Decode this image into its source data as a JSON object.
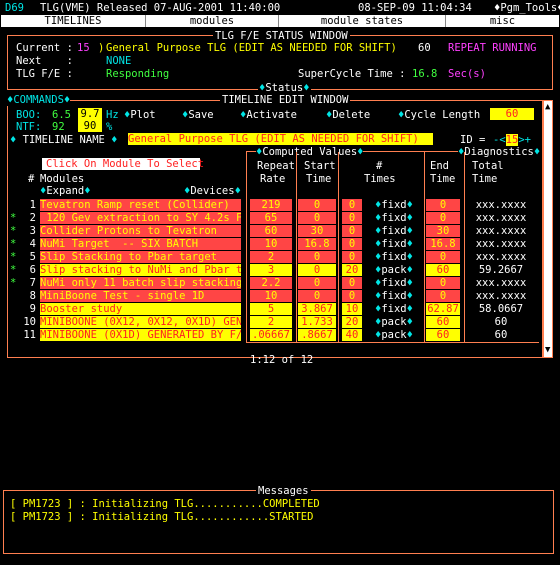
{
  "header": {
    "console": "D69",
    "app": "TLG(VME) Released 07-AUG-2001 11:40:00",
    "datetime": "08-SEP-09 11:04:34",
    "tools": "♦Pgm_Tools♦"
  },
  "menu": [
    "TIMELINES",
    "modules",
    "module states",
    "misc"
  ],
  "status": {
    "title": "TLG F/E STATUS WINDOW",
    "current_label": "Current :",
    "current_id": "15",
    "current_sep": ")",
    "current_name": "General Purpose TLG (EDIT AS NEEDED FOR SHIFT)",
    "current_value": "60",
    "repeat": "REPEAT RUNNING",
    "next_label": "Next    :",
    "next_value": "NONE",
    "fe_label": "TLG F/E :",
    "fe_value": "Responding",
    "supercycle_label": "SuperCycle Time :",
    "supercycle_value": "16.8",
    "supercycle_unit": "Sec(s)",
    "status_tab": "Status"
  },
  "edit": {
    "commands": "COMMANDS",
    "title": "TIMELINE EDIT WINDOW",
    "boo_label": "BOO:",
    "boo_value": "6.5",
    "boo_hz_box": "9.7",
    "hz": "Hz",
    "plot": "Plot",
    "save": "Save",
    "activate": "Activate",
    "delete": "Delete",
    "cycle_length": "Cycle Length",
    "cycle_value": "60",
    "ntf_label": "NTF:",
    "ntf_value": "92",
    "ntf_box": "90",
    "pct": "%",
    "timeline_name_label": "TIMELINE NAME",
    "timeline_name": "General Purpose TLG (EDIT AS NEEDED FOR SHIFT)",
    "id_label": "ID = ",
    "id_value": "15",
    "computed_values": "Computed Values",
    "diagnostics": "Diagnostics",
    "click_module": "Click On Module To Select",
    "hash": "#",
    "modules": "Modules",
    "expand": "Expand",
    "devices": "Devices",
    "col_repeat": "Repeat",
    "col_rate": "Rate",
    "col_start": "Start",
    "col_start2": "Time",
    "col_times": "#",
    "col_times2": "Times",
    "col_end": "End",
    "col_end2": "Time",
    "col_total": "Total",
    "col_total2": "Time",
    "page": "1:12 of 12"
  },
  "rows": [
    {
      "mark": "",
      "n": "1",
      "name": "Tevatron Ramp reset (Collider)",
      "rate": "219",
      "start": "0",
      "times": "0",
      "kind": "fixd",
      "end": "0",
      "total": "xxx.xxxx",
      "color": "red"
    },
    {
      "mark": "*",
      "n": "2",
      "name": " 120 Gev extraction to SY 4.2s FT",
      "rate": "65",
      "start": "0",
      "times": "0",
      "kind": "fixd",
      "end": "0",
      "total": "xxx.xxxx",
      "color": "red"
    },
    {
      "mark": "*",
      "n": "3",
      "name": "Collider Protons to Tevatron",
      "rate": "60",
      "start": "30",
      "times": "0",
      "kind": "fixd",
      "end": "30",
      "total": "xxx.xxxx",
      "color": "red"
    },
    {
      "mark": "*",
      "n": "4",
      "name": "NuMi Target  -- SIX BATCH",
      "rate": "10",
      "start": "16.8",
      "times": "0",
      "kind": "fixd",
      "end": "16.8",
      "total": "xxx.xxxx",
      "color": "red"
    },
    {
      "mark": "*",
      "n": "5",
      "name": "Slip Stacking to Pbar target",
      "rate": "2",
      "start": "0",
      "times": "0",
      "kind": "fixd",
      "end": "0",
      "total": "xxx.xxxx",
      "color": "red"
    },
    {
      "mark": "*",
      "n": "6",
      "name": "Slip stacking to NuMi and Pbar ta",
      "rate": "3",
      "start": "0",
      "times": "20",
      "kind": "pack",
      "end": "60",
      "total": "59.2667",
      "color": "yellow"
    },
    {
      "mark": "*",
      "n": "7",
      "name": "NuMi only 11 batch slip stacking",
      "rate": "2.2",
      "start": "0",
      "times": "0",
      "kind": "fixd",
      "end": "0",
      "total": "xxx.xxxx",
      "color": "red"
    },
    {
      "mark": "",
      "n": "8",
      "name": "MiniBoone Test - single 1D",
      "rate": "10",
      "start": "0",
      "times": "0",
      "kind": "fixd",
      "end": "0",
      "total": "xxx.xxxx",
      "color": "red"
    },
    {
      "mark": "",
      "n": "9",
      "name": "Booster study",
      "rate": "5",
      "start": "3.867",
      "times": "10",
      "kind": "fixd",
      "end": "62.87",
      "total": "58.0667",
      "color": "yellow"
    },
    {
      "mark": "",
      "n": "10",
      "name": "MINIBOONE (0X12, 0X12, 0X1D) GENE",
      "rate": "2",
      "start": "1.733",
      "times": "20",
      "kind": "pack",
      "end": "60",
      "total": "60",
      "color": "yellow"
    },
    {
      "mark": "",
      "n": "11",
      "name": "MINIBOONE (0X1D) GENERATED BY F/E",
      ".rate": "",
      "rate": ".06667",
      "start": ".8667",
      "times": "40",
      "kind": "pack",
      "end": "60",
      "total": "60",
      "color": "yellow"
    }
  ],
  "messages": {
    "title": "Messages",
    "lines": [
      "[ PM1723 ] : Initializing TLG...........COMPLETED",
      "[ PM1723 ] : Initializing TLG............STARTED"
    ]
  },
  "colors": {
    "accent": "#ff7f50",
    "cyan": "#00e5e5",
    "yellow": "#ffff00",
    "green": "#40ff40",
    "magenta": "#ff40ff",
    "red_cell": "#ff4545"
  }
}
